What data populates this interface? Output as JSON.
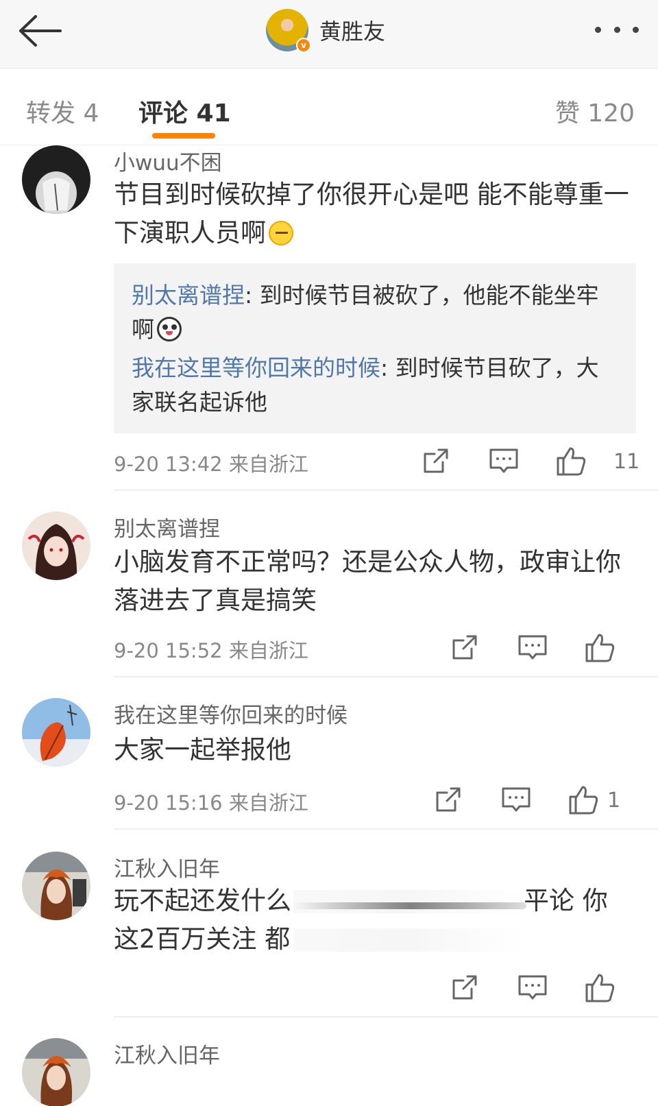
{
  "header": {
    "account_name": "黄胜友",
    "back_icon": "arrow-left-icon",
    "more_icon": "more-dots-icon"
  },
  "tabs": [
    {
      "label": "转发 4"
    },
    {
      "label": "评论 41"
    },
    {
      "label": "赞 120"
    }
  ],
  "colors": {
    "accent": "#ff8200",
    "link": "#5178a8",
    "reply_bg": "#f3f3f3"
  },
  "comments": [
    {
      "user": "小wuu不困",
      "text": "节目到时候砍掉了你很开心是吧 能不能尊重一下演职人员啊",
      "replies": [
        {
          "name": "别太离谱捏",
          "text": ": 到时候节目被砍了，他能不能坐牢啊"
        },
        {
          "name": "我在这里等你回来的时候",
          "text": ": 到时候节目砍了，大家联名起诉他"
        }
      ],
      "time": "9-20 13:42",
      "location": "来自浙江",
      "likes": "11"
    },
    {
      "user": "别太离谱捏",
      "text": "小脑发育不正常吗？还是公众人物，政审让你落进去了真是搞笑",
      "time": "9-20 15:52",
      "location": "来自浙江",
      "likes": ""
    },
    {
      "user": "我在这里等你回来的时候",
      "text": "大家一起举报他",
      "time": "9-20 15:16",
      "location": "来自浙江",
      "likes": "1"
    },
    {
      "user": "江秋入旧年",
      "text_line1_start": "玩不起还发什么",
      "text_line1_end": "平论 你",
      "text_line2_start": "这2百万关注 都"
    },
    {
      "user": "江秋入旧年"
    }
  ]
}
